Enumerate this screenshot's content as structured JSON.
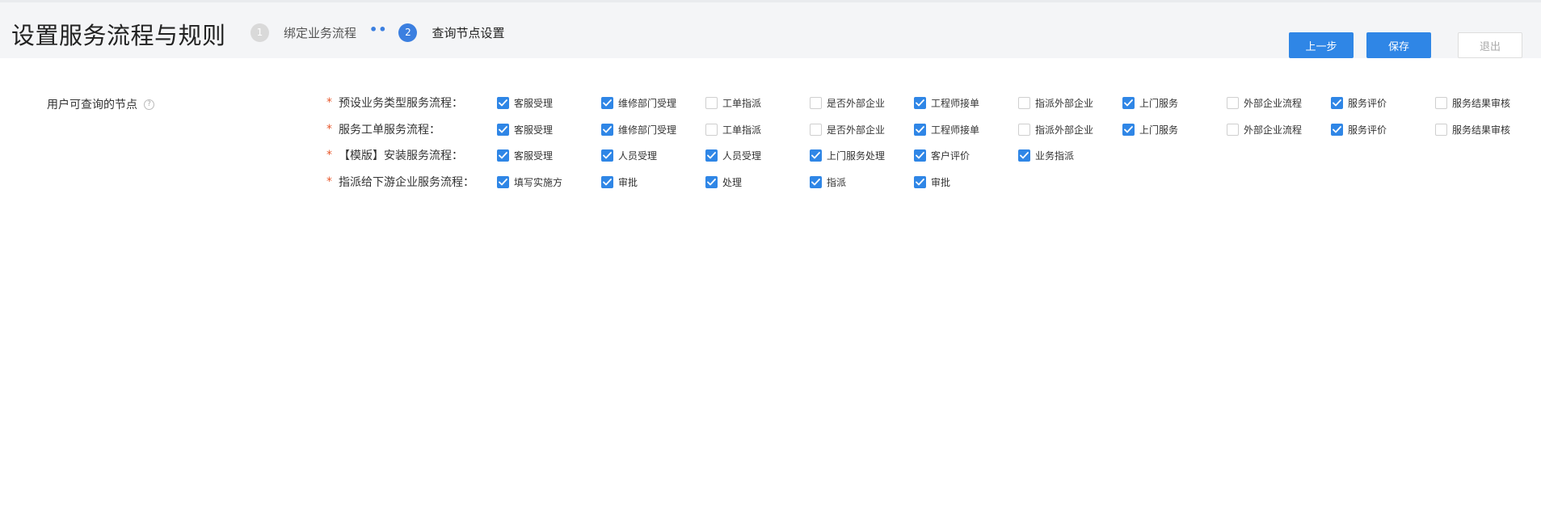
{
  "header": {
    "title": "设置服务流程与规则",
    "steps": [
      {
        "number": "1",
        "label": "绑定业务流程",
        "state": "done"
      },
      {
        "number": "2",
        "label": "查询节点设置",
        "state": "active"
      }
    ],
    "step_separator": "••",
    "buttons": {
      "prev": "上一步",
      "save": "保存",
      "exit": "退出"
    }
  },
  "form": {
    "field_label": "用户可查询的节点",
    "help_icon": "?",
    "required_mark": "*",
    "flows": [
      {
        "label": "预设业务类型服务流程：",
        "nodes": [
          {
            "label": "客服受理",
            "checked": true
          },
          {
            "label": "维修部门受理",
            "checked": true
          },
          {
            "label": "工单指派",
            "checked": false
          },
          {
            "label": "是否外部企业",
            "checked": false
          },
          {
            "label": "工程师接单",
            "checked": true
          },
          {
            "label": "指派外部企业",
            "checked": false
          },
          {
            "label": "上门服务",
            "checked": true
          },
          {
            "label": "外部企业流程",
            "checked": false
          },
          {
            "label": "服务评价",
            "checked": true
          },
          {
            "label": "服务结果审核",
            "checked": false
          }
        ]
      },
      {
        "label": "服务工单服务流程：",
        "nodes": [
          {
            "label": "客服受理",
            "checked": true
          },
          {
            "label": "维修部门受理",
            "checked": true
          },
          {
            "label": "工单指派",
            "checked": false
          },
          {
            "label": "是否外部企业",
            "checked": false
          },
          {
            "label": "工程师接单",
            "checked": true
          },
          {
            "label": "指派外部企业",
            "checked": false
          },
          {
            "label": "上门服务",
            "checked": true
          },
          {
            "label": "外部企业流程",
            "checked": false
          },
          {
            "label": "服务评价",
            "checked": true
          },
          {
            "label": "服务结果审核",
            "checked": false
          }
        ]
      },
      {
        "label": "【模版】安装服务流程：",
        "nodes": [
          {
            "label": "客服受理",
            "checked": true
          },
          {
            "label": "人员受理",
            "checked": true
          },
          {
            "label": "人员受理",
            "checked": true
          },
          {
            "label": "上门服务处理",
            "checked": true
          },
          {
            "label": "客户评价",
            "checked": true
          },
          {
            "label": "业务指派",
            "checked": true
          }
        ]
      },
      {
        "label": "指派给下游企业服务流程：",
        "nodes": [
          {
            "label": "填写实施方",
            "checked": true
          },
          {
            "label": "审批",
            "checked": true
          },
          {
            "label": "处理",
            "checked": true
          },
          {
            "label": "指派",
            "checked": true
          },
          {
            "label": "审批",
            "checked": true
          }
        ]
      }
    ]
  },
  "colors": {
    "accent": "#2f86e6",
    "required": "#e8592c",
    "header_bg": "#f4f5f7"
  }
}
